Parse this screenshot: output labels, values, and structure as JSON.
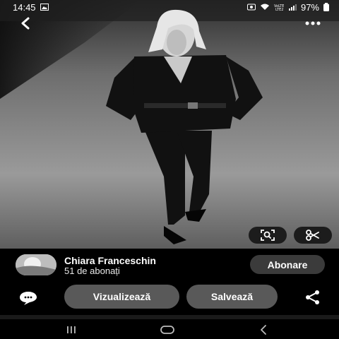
{
  "status_bar": {
    "time": "14:45",
    "battery": "97%",
    "icons": [
      "gallery-icon",
      "screen-record-icon",
      "wifi-icon",
      "volte-icon",
      "signal-icon",
      "battery-icon"
    ]
  },
  "top_bar": {
    "back_icon": "chevron-left-icon",
    "more_icon": "more-dots-icon"
  },
  "image_tools": {
    "lens_icon": "visual-search-icon",
    "cut_icon": "scissors-icon"
  },
  "creator": {
    "name": "Chiara Franceschin",
    "followers": "51 de abonați",
    "follow_label": "Abonare"
  },
  "actions": {
    "comment_icon": "comment-icon",
    "view_label": "Vizualizează",
    "save_label": "Salvează",
    "share_icon": "share-icon"
  },
  "nav_bar": {
    "recent_icon": "recent-apps-icon",
    "home_icon": "home-icon",
    "back_icon": "back-icon"
  },
  "colors": {
    "background": "#000000",
    "button": "#595959",
    "follow_button": "#3b3b3b",
    "icon_pill": "#1c1c1c"
  }
}
